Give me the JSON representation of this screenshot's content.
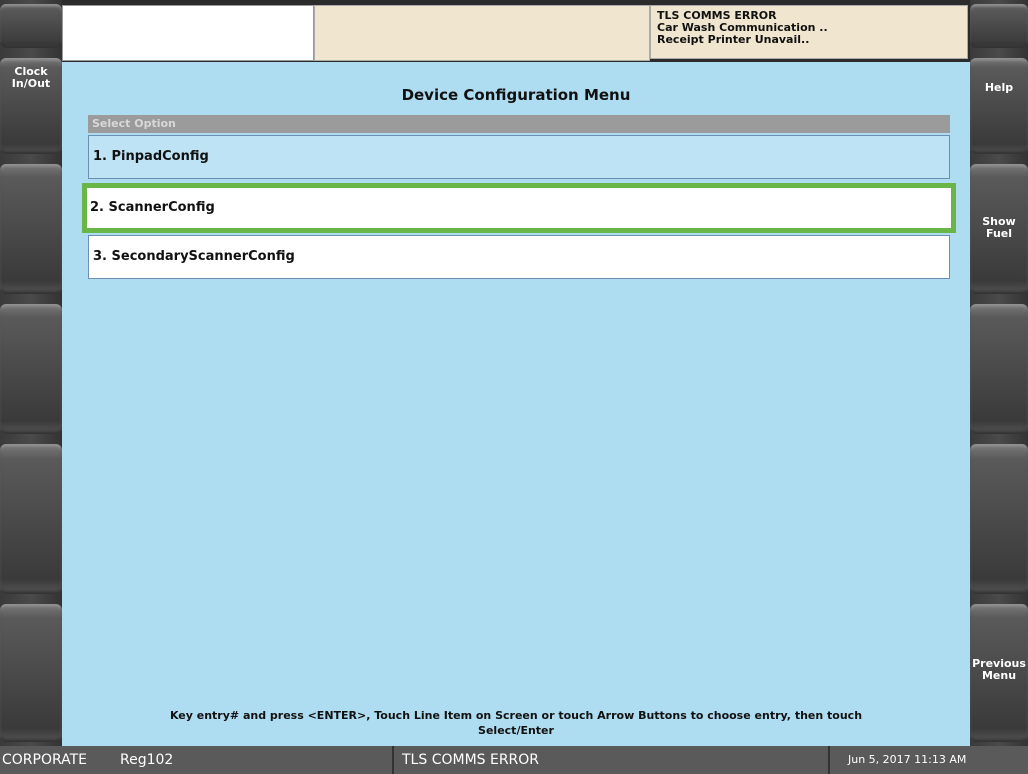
{
  "left_softkeys": [
    {
      "label": ""
    },
    {
      "label": "Clock\nIn/Out"
    },
    {
      "label": ""
    },
    {
      "label": ""
    },
    {
      "label": ""
    },
    {
      "label": ""
    }
  ],
  "right_softkeys": [
    {
      "label": ""
    },
    {
      "label": "Help"
    },
    {
      "label": "Show\nFuel"
    },
    {
      "label": ""
    },
    {
      "label": ""
    },
    {
      "label": "Previous\nMenu"
    }
  ],
  "alerts": [
    "TLS COMMS ERROR",
    "Car Wash Communication ..",
    "Receipt Printer Unavail.."
  ],
  "menu": {
    "title": "Device Configuration Menu",
    "header": "Select Option",
    "items": [
      "1. PinpadConfig",
      "2. ScannerConfig",
      "3. SecondaryScannerConfig"
    ],
    "hint_line1": "Key entry# and press <ENTER>, Touch Line Item on Screen or touch Arrow Buttons to choose entry, then touch",
    "hint_line2": "Select/Enter"
  },
  "status": {
    "store": "CORPORATE",
    "register": "Reg102",
    "message": "TLS COMMS ERROR",
    "datetime": "Jun 5, 2017 11:13 AM"
  }
}
